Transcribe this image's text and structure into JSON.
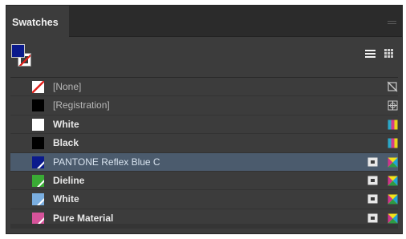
{
  "panel": {
    "tab_label": "Swatches"
  },
  "current": {
    "fill_color": "#0b1a8c",
    "stroke": "none"
  },
  "view": {
    "list_icon": "list-view-icon",
    "grid_icon": "grid-view-icon"
  },
  "swatches": [
    {
      "label": "[None]",
      "color": "none",
      "type": "none",
      "icon_a": "",
      "icon_b": "no-print-icon",
      "dim": true
    },
    {
      "label": "[Registration]",
      "color": "#000000",
      "type": "process",
      "icon_a": "",
      "icon_b": "registration-icon",
      "dim": true
    },
    {
      "label": "White",
      "color": "#ffffff",
      "type": "process",
      "icon_a": "",
      "icon_b": "cmyk-icon",
      "dim": false
    },
    {
      "label": "Black",
      "color": "#000000",
      "type": "process",
      "icon_a": "",
      "icon_b": "cmyk-icon",
      "dim": false
    },
    {
      "label": "PANTONE Reflex Blue C",
      "color": "#0b1a8c",
      "type": "spot",
      "icon_a": "spot-icon",
      "icon_b": "lab-icon",
      "dim": false,
      "selected": true
    },
    {
      "label": "Dieline",
      "color": "#3aaa35",
      "type": "spot",
      "icon_a": "spot-icon",
      "icon_b": "lab-icon",
      "dim": false
    },
    {
      "label": "White",
      "color": "#7aaee0",
      "type": "spot",
      "icon_a": "spot-icon",
      "icon_b": "lab-icon",
      "dim": false
    },
    {
      "label": "Pure Material",
      "color": "#d6539a",
      "type": "spot",
      "icon_a": "spot-icon",
      "icon_b": "lab-icon",
      "dim": false
    }
  ]
}
